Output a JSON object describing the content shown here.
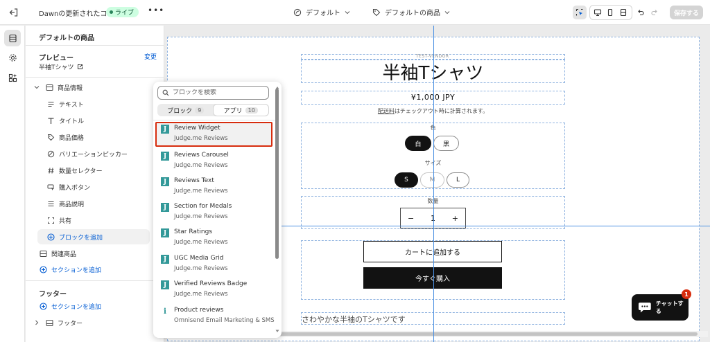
{
  "topbar": {
    "theme_name": "Dawnの更新されたコピー",
    "live_badge": "ライブ",
    "more": "•••",
    "template_select": "デフォルト",
    "page_select": "デフォルトの商品",
    "save_label": "保存する"
  },
  "sidebar": {
    "title": "デフォルトの商品",
    "preview_label": "プレビュー",
    "change_link": "変更",
    "preview_value": "半袖Tシャツ",
    "product_info_section": "商品情報",
    "blocks": [
      {
        "label": "テキスト",
        "icon": "text-icon"
      },
      {
        "label": "タイトル",
        "icon": "title-icon"
      },
      {
        "label": "商品価格",
        "icon": "price-tag-icon"
      },
      {
        "label": "バリエーションピッカー",
        "icon": "variant-picker-icon"
      },
      {
        "label": "数量セレクター",
        "icon": "hash-icon"
      },
      {
        "label": "購入ボタン",
        "icon": "buy-button-icon"
      },
      {
        "label": "商品説明",
        "icon": "description-icon"
      },
      {
        "label": "共有",
        "icon": "share-icon"
      }
    ],
    "add_block": "ブロックを追加",
    "related_products": "関連商品",
    "add_section": "セクションを追加",
    "footer_group_label": "フッター",
    "footer_add_section": "セクションを追加",
    "footer_section": "フッター"
  },
  "picker": {
    "search_placeholder": "ブロックを検索",
    "tabs": [
      {
        "label": "ブロック",
        "count": "9"
      },
      {
        "label": "アプリ",
        "count": "10"
      }
    ],
    "items": [
      {
        "name": "Review Widget",
        "vendor": "Judge.me Reviews"
      },
      {
        "name": "Reviews Carousel",
        "vendor": "Judge.me Reviews"
      },
      {
        "name": "Reviews Text",
        "vendor": "Judge.me Reviews"
      },
      {
        "name": "Section for Medals",
        "vendor": "Judge.me Reviews"
      },
      {
        "name": "Star Ratings",
        "vendor": "Judge.me Reviews"
      },
      {
        "name": "UGC Media Grid",
        "vendor": "Judge.me Reviews"
      },
      {
        "name": "Verified Reviews Badge",
        "vendor": "Judge.me Reviews"
      },
      {
        "name": "Product reviews",
        "vendor": "Omnisend Email Marketing & SMS"
      }
    ]
  },
  "preview": {
    "vendor": "TEST-VENDOR",
    "title": "半袖Tシャツ",
    "price": "¥1,000 JPY",
    "shipping_link": "配送料",
    "shipping_note": "はチェックアウト時に計算されます。",
    "color_label": "色",
    "colors": [
      "白",
      "黒"
    ],
    "size_label": "サイズ",
    "sizes": [
      "S",
      "M",
      "L"
    ],
    "qty_label": "数量",
    "qty_minus": "−",
    "qty_value": "1",
    "qty_plus": "+",
    "add_to_cart": "カートに追加する",
    "buy_now": "今すぐ購入",
    "description": "さわやかな半袖のTシャツです"
  },
  "chat": {
    "label": "チャットする",
    "badge": "1"
  }
}
